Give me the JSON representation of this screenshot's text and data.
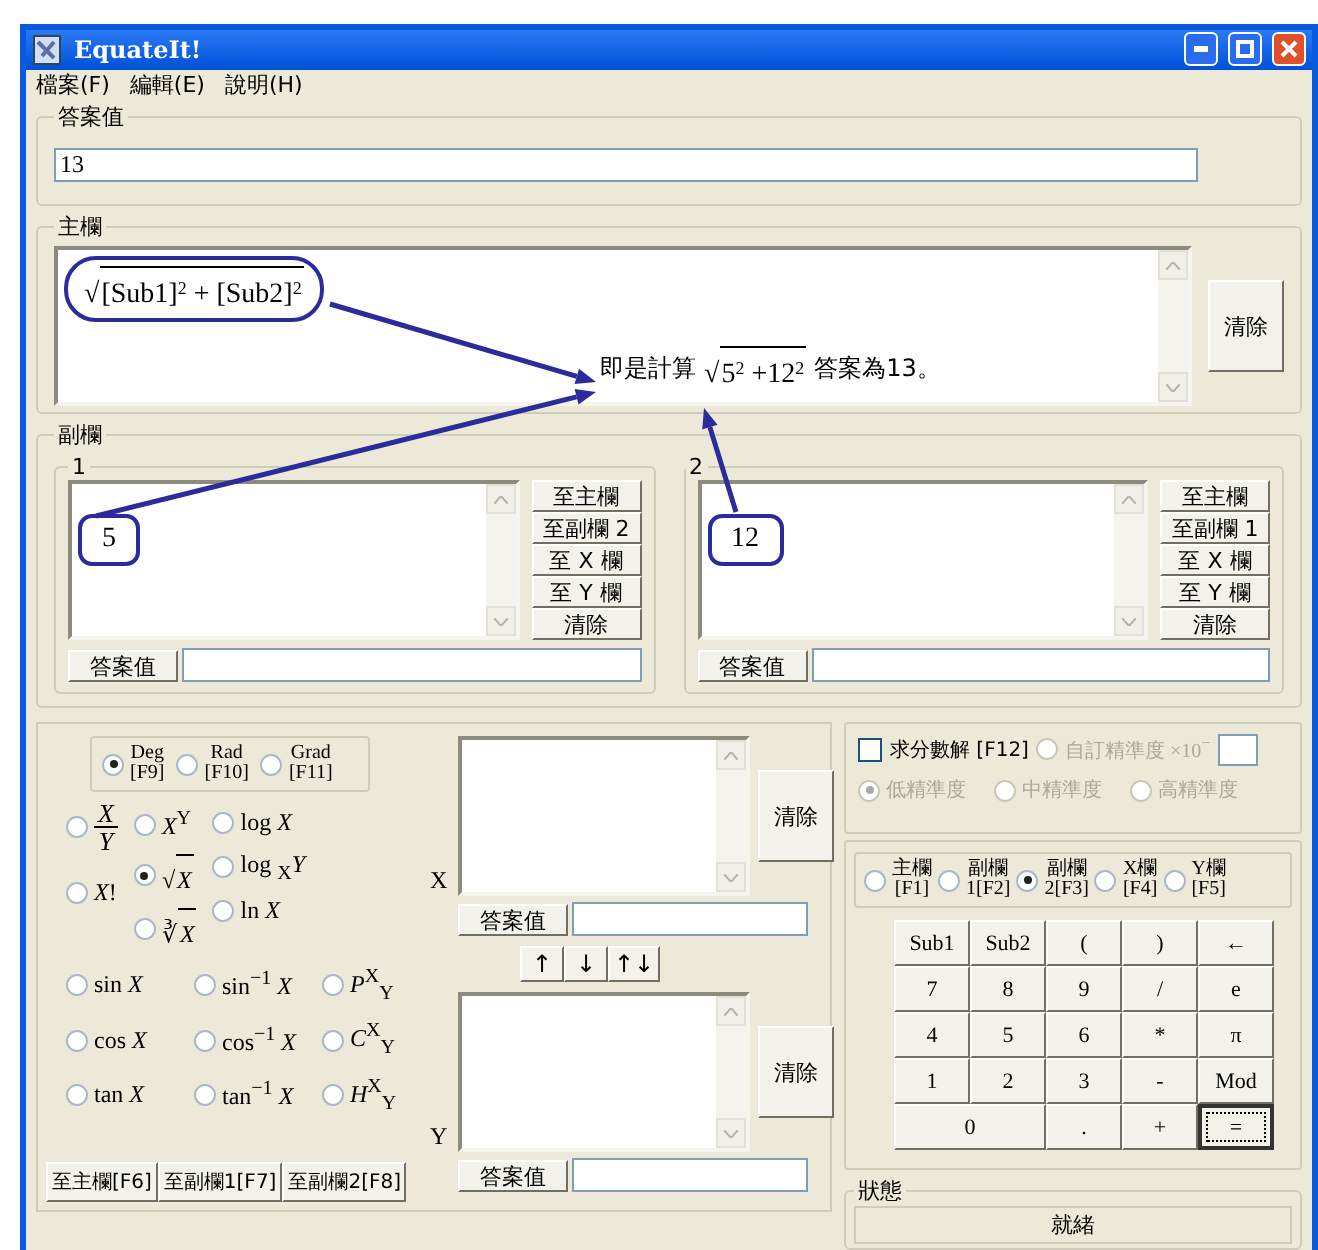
{
  "window": {
    "title": "EquateIt!"
  },
  "menu": [
    "檔案(F)",
    "編輯(E)",
    "說明(H)"
  ],
  "answer": {
    "label": "答案值",
    "value": "13"
  },
  "main": {
    "label": "主欄",
    "formula": {
      "radical": "√",
      "radicand": "[Sub1]$^{2}$ + [Sub2]$^{2}$"
    },
    "note": {
      "before": "即是計算",
      "radical": "√",
      "radicand": "5$^{2}$ +12$^{2}$",
      "after": "答案為13。"
    },
    "clear": "清除"
  },
  "sub": {
    "label": "副欄",
    "panels": [
      {
        "label": "1",
        "value": "5",
        "buttons": [
          "至主欄",
          "至副欄 2",
          "至 X 欄",
          "至 Y 欄",
          "清除"
        ],
        "answer_button": "答案值"
      },
      {
        "label": "2",
        "value": "12",
        "buttons": [
          "至主欄",
          "至副欄 1",
          "至 X 欄",
          "至 Y 欄",
          "清除"
        ],
        "answer_button": "答案值"
      }
    ]
  },
  "angle": [
    {
      "top": "Deg",
      "bottom": "[F9]",
      "selected": true
    },
    {
      "top": "Rad",
      "bottom": "[F10]",
      "selected": false
    },
    {
      "top": "Grad",
      "bottom": "[F11]",
      "selected": false
    }
  ],
  "functions_top": [
    [
      {
        "kind": "fraction",
        "num": "X",
        "den": "Y",
        "selected": false
      },
      {
        "kind": "text",
        "label": "*X*!",
        "selected": false
      }
    ],
    [
      {
        "kind": "text",
        "label": "*X*$^{Y}$",
        "selected": false
      },
      {
        "kind": "root",
        "radical": "√",
        "radicand": "X",
        "selected": true
      },
      {
        "kind": "root",
        "radical": "∛",
        "radicand": "X",
        "selected": false
      }
    ],
    [
      {
        "kind": "text",
        "label": "log *X*",
        "selected": false
      },
      {
        "kind": "text",
        "label": "log $_{X}$*Y*",
        "selected": false
      },
      {
        "kind": "text",
        "label": "ln *X*",
        "selected": false
      }
    ]
  ],
  "functions_trig": [
    [
      {
        "label": "sin *X*",
        "selected": false
      },
      {
        "label": "sin$^{−1}$ *X*",
        "selected": false
      },
      {
        "label": "*P*$^{X}$$_{Y}$",
        "selected": false
      }
    ],
    [
      {
        "label": "cos *X*",
        "selected": false
      },
      {
        "label": "cos$^{−1}$ *X*",
        "selected": false
      },
      {
        "label": "*C*$^{X}$$_{Y}$",
        "selected": false
      }
    ],
    [
      {
        "label": "tan *X*",
        "selected": false
      },
      {
        "label": "tan$^{−1}$ *X*",
        "selected": false
      },
      {
        "label": "*H*$^{X}$$_{Y}$",
        "selected": false
      }
    ]
  ],
  "send_buttons": [
    "至主欄[F6]",
    "至副欄1[F7]",
    "至副欄2[F8]"
  ],
  "x_field": {
    "label": "X",
    "clear": "清除",
    "answer_button": "答案值"
  },
  "swap_buttons": [
    "↑",
    "↓",
    "↑↓"
  ],
  "y_field": {
    "label": "Y",
    "clear": "清除",
    "answer_button": "答案值"
  },
  "fraction": {
    "label": "求分數解 [F12]",
    "checked": false,
    "custom": {
      "label": "自訂精準度 ×10",
      "exponent": "−",
      "selected": false,
      "disabled": true
    },
    "precision": [
      {
        "label": "低精準度",
        "selected": true,
        "disabled": true
      },
      {
        "label": "中精準度",
        "selected": false,
        "disabled": true
      },
      {
        "label": "高精準度",
        "selected": false,
        "disabled": true
      }
    ]
  },
  "targets": [
    {
      "top": "主欄",
      "bottom": "[F1]",
      "selected": false
    },
    {
      "top": "副欄",
      "bottom": "1[F2]",
      "selected": false
    },
    {
      "top": "副欄",
      "bottom": "2[F3]",
      "selected": true
    },
    {
      "top": "X欄",
      "bottom": "[F4]",
      "selected": false
    },
    {
      "top": "Y欄",
      "bottom": "[F5]",
      "selected": false
    }
  ],
  "keypad": [
    {
      "label": "Sub1"
    },
    {
      "label": "Sub2"
    },
    {
      "label": "("
    },
    {
      "label": ")"
    },
    {
      "label": "←"
    },
    {
      "label": "7"
    },
    {
      "label": "8"
    },
    {
      "label": "9"
    },
    {
      "label": "/"
    },
    {
      "label": "e"
    },
    {
      "label": "4"
    },
    {
      "label": "5"
    },
    {
      "label": "6"
    },
    {
      "label": "*"
    },
    {
      "label": "π"
    },
    {
      "label": "1"
    },
    {
      "label": "2"
    },
    {
      "label": "3"
    },
    {
      "label": "-"
    },
    {
      "label": "Mod"
    },
    {
      "label": "0",
      "wide": true
    },
    {
      "label": "."
    },
    {
      "label": "+"
    },
    {
      "label": "=",
      "focused": true
    }
  ],
  "status": {
    "label": "狀態",
    "value": "就緒"
  }
}
